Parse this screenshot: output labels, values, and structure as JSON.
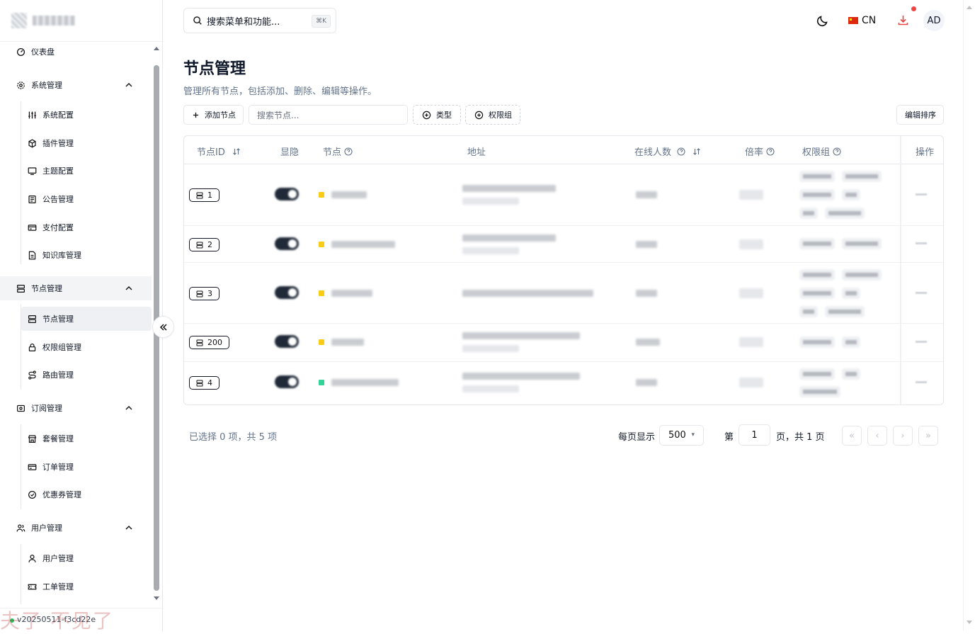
{
  "brand": {
    "name": "管理Tools"
  },
  "sidebar": {
    "dashboard": "仪表盘",
    "groups": [
      {
        "label": "系统管理",
        "children": [
          "系统配置",
          "插件管理",
          "主题配置",
          "公告管理",
          "支付配置",
          "知识库管理"
        ]
      },
      {
        "label": "节点管理",
        "children": [
          "节点管理",
          "权限组管理",
          "路由管理"
        ]
      },
      {
        "label": "订阅管理",
        "children": [
          "套餐管理",
          "订单管理",
          "优惠券管理"
        ]
      },
      {
        "label": "用户管理",
        "children": [
          "用户管理",
          "工单管理"
        ]
      }
    ],
    "version": "v20250511-f3cd22e"
  },
  "watermark": "夫了 不见了",
  "topbar": {
    "search_placeholder": "搜索菜单和功能...",
    "shortcut": "⌘K",
    "language": "CN",
    "avatar": "AD"
  },
  "page": {
    "title": "节点管理",
    "description": "管理所有节点，包括添加、删除、编辑等操作。"
  },
  "toolbar": {
    "add_node": "添加节点",
    "search_placeholder": "搜索节点...",
    "type_filter": "类型",
    "group_filter": "权限组",
    "edit_sort": "编辑排序"
  },
  "table": {
    "headers": [
      "节点ID",
      "显隐",
      "节点",
      "地址",
      "在线人数",
      "倍率",
      "权限组",
      "操作"
    ],
    "rows": [
      {
        "id": "1",
        "status_color": "#facc15"
      },
      {
        "id": "2",
        "status_color": "#facc15"
      },
      {
        "id": "3",
        "status_color": "#facc15"
      },
      {
        "id": "200",
        "status_color": "#facc15"
      },
      {
        "id": "4",
        "status_color": "#34d399"
      }
    ]
  },
  "pagination": {
    "selection_info": "已选择 0 项，共 5 项",
    "per_page_label": "每页显示",
    "per_page_value": "500",
    "page_prefix": "第",
    "current_page": "1",
    "page_suffix": "页，共 1 页",
    "first": "«",
    "prev": "‹",
    "next": "›",
    "last": "»"
  },
  "colors": {
    "accent": "#0f172a",
    "muted": "#64748b",
    "danger": "#ef4444"
  }
}
